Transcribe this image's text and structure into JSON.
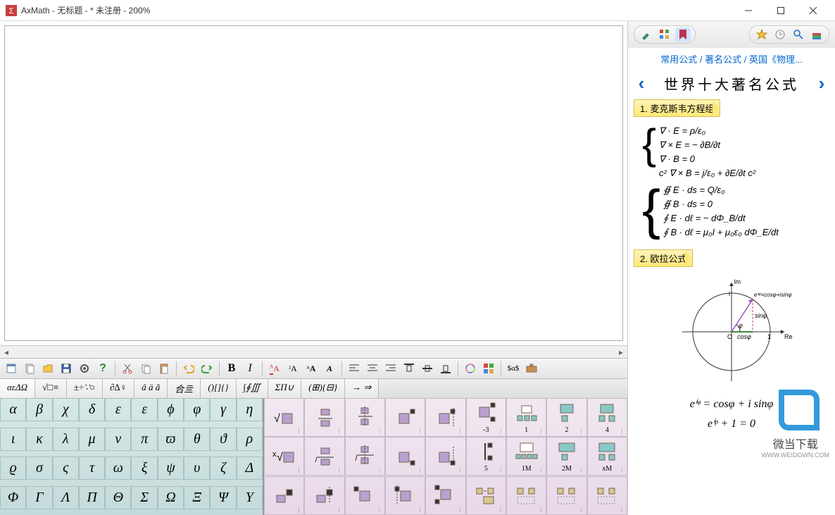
{
  "window": {
    "title": "AxMath - 无标题 - * 未注册 - 200%"
  },
  "breadcrumb": {
    "a": "常用公式",
    "b": "著名公式",
    "c": "英国《物理...",
    "sep": " / "
  },
  "nav": {
    "title": "世界十大著名公式"
  },
  "sections": {
    "s1": "1. 麦克斯韦方程组",
    "s2": "2. 欧拉公式"
  },
  "maxwell": {
    "e1": "∇ · E = ρ/ε₀",
    "e2": "∇ × E = − ∂B/∂t",
    "e3": "∇ · B = 0",
    "e4": "c² ∇ × B = j/ε₀ + ∂E/∂t c²",
    "i1": "∯ E · ds = Q/ε₀",
    "i2": "∯ B · ds = 0",
    "i3": "∮ E · dℓ = − dΦ_B/dt",
    "i4": "∮ B · dℓ = μ₀I + μ₀ε₀ dΦ_E/dt"
  },
  "euler": {
    "im": "Im",
    "re": "Re",
    "vec": "eⁱᵠ = cosφ + i sinφ",
    "sin": "sinφ",
    "cos": "cosφ",
    "phi": "φ",
    "eq1": "eⁱᵠ = cosφ + i sinφ",
    "eq2": "eⁱᵖ + 1 = 0"
  },
  "tabs": {
    "t0": "αεΔΩ",
    "t1": "√□≡",
    "t2": "±÷∵○",
    "t3": "∂∆♀",
    "t4": "â ä ã",
    "t5": "合亖",
    "t6": "()[]{​}",
    "t7": "∫∮∭",
    "t8": "ΣΠ∪",
    "t9": "(⊞){⊟}",
    "t10": "→ ⇒"
  },
  "greek": [
    "α",
    "β",
    "χ",
    "δ",
    "ε",
    "ε",
    "ϕ",
    "φ",
    "γ",
    "η",
    "ι",
    "κ",
    "λ",
    "μ",
    "ν",
    "π",
    "ϖ",
    "θ",
    "ϑ",
    "ρ",
    "ϱ",
    "σ",
    "ς",
    "τ",
    "ω",
    "ξ",
    "ψ",
    "υ",
    "ζ",
    "Δ",
    "Φ",
    "Γ",
    "Λ",
    "Π",
    "Θ",
    "Σ",
    "Ω",
    "Ξ",
    "Ψ",
    "Υ"
  ],
  "struct_labels": {
    "l36": "-3",
    "l37": "1",
    "l38": "2",
    "l39": "4",
    "l56": "5",
    "l57": "1M",
    "l58": "2M",
    "l59": "xM"
  },
  "toolbar": {
    "bold": "B",
    "italic": "I",
    "fA1": "A",
    "fA2": "A",
    "fA3": "A",
    "fA4": "A"
  },
  "watermark": {
    "text": "微当下载",
    "url": "WWW.WEIDOWN.COM"
  }
}
